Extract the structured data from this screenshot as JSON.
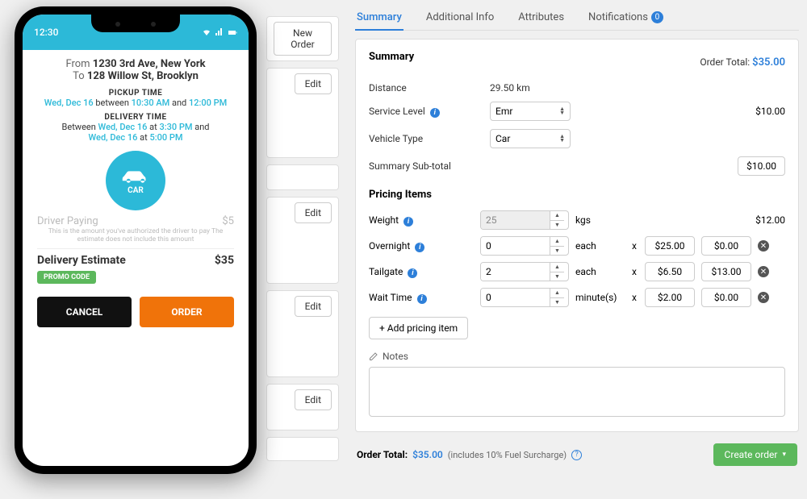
{
  "phone": {
    "time": "12:30",
    "from_prefix": "From ",
    "from_addr": "1230 3rd Ave, New York",
    "to_prefix": "To ",
    "to_addr": "128 Willow St, Brooklyn",
    "pickup_label": "PICKUP TIME",
    "pickup_date": "Wed, Dec 16",
    "pickup_between": " between ",
    "pickup_t1": "10:30 AM",
    "pickup_and": " and ",
    "pickup_t2": "12:00 PM",
    "delivery_label": "DELIVERY TIME",
    "delivery_between": "Between ",
    "delivery_date1": "Wed, Dec 16",
    "delivery_at1": " at ",
    "delivery_t1": "3:30 PM",
    "delivery_and": " and",
    "delivery_date2": "Wed, Dec 16",
    "delivery_at2": " at ",
    "delivery_t2": "5:00 PM",
    "vehicle_label": "CAR",
    "driver_label": "Driver Paying",
    "driver_amount": "$5",
    "driver_note": "This is the amount you've authorized the driver to pay The estimate does not include this amount",
    "estimate_label": "Delivery Estimate",
    "estimate_amount": "$35",
    "promo": "PROMO CODE",
    "cancel": "CANCEL",
    "order": "ORDER"
  },
  "mid": {
    "new_order": "New Order",
    "edit": "Edit"
  },
  "tabs": {
    "summary": "Summary",
    "additional": "Additional Info",
    "attributes": "Attributes",
    "notifications": "Notifications",
    "notif_count": "0"
  },
  "summary": {
    "heading": "Summary",
    "order_total_label": "Order Total: ",
    "order_total": "$35.00",
    "distance_label": "Distance",
    "distance_val": "29.50 km",
    "service_label": "Service Level",
    "service_val": "Emr",
    "service_price": "$10.00",
    "vehicle_label": "Vehicle Type",
    "vehicle_val": "Car",
    "subtotal_label": "Summary Sub-total",
    "subtotal_val": "$10.00"
  },
  "pricing": {
    "heading": "Pricing Items",
    "weight_label": "Weight",
    "weight_val": "25",
    "weight_unit": "kgs",
    "weight_price": "$12.00",
    "overnight_label": "Overnight",
    "overnight_val": "0",
    "overnight_unit": "each",
    "overnight_rate": "$25.00",
    "overnight_price": "$0.00",
    "tailgate_label": "Tailgate",
    "tailgate_val": "2",
    "tailgate_unit": "each",
    "tailgate_rate": "$6.50",
    "tailgate_price": "$13.00",
    "wait_label": "Wait Time",
    "wait_val": "0",
    "wait_unit": "minute(s)",
    "wait_rate": "$2.00",
    "wait_price": "$0.00",
    "x": "x",
    "add": "+ Add pricing item"
  },
  "notes": {
    "label": "Notes"
  },
  "footer": {
    "label": "Order Total:",
    "val": "$35.00",
    "surcharge": "(includes 10% Fuel Surcharge)",
    "create": "Create order"
  }
}
